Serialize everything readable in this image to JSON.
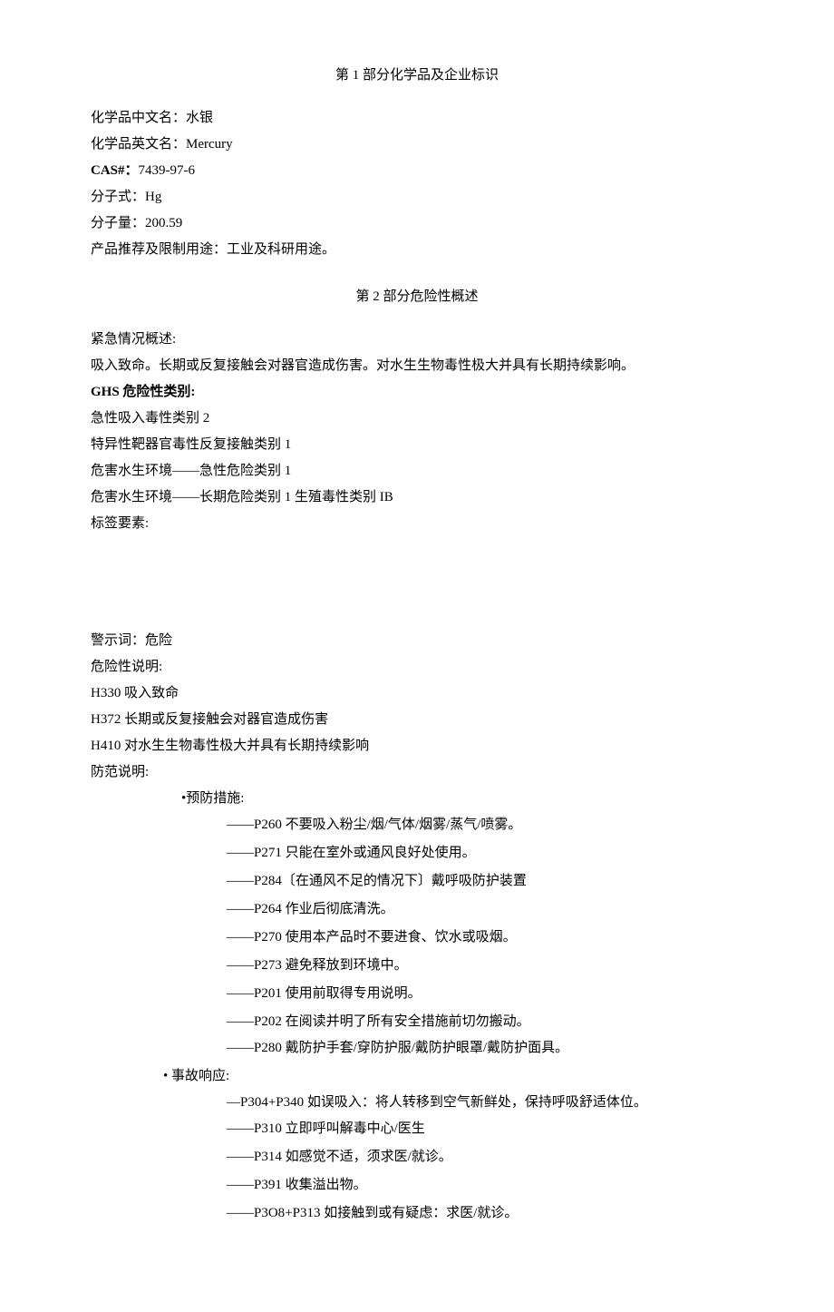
{
  "section1": {
    "title": "第 1 部分化学品及企业标识",
    "name_cn_label": "化学品中文名：",
    "name_cn": "水银",
    "name_en_label": "化学品英文名：",
    "name_en": "Mercury",
    "cas_label": "CAS#：",
    "cas": "7439-97-6",
    "formula_label": "分子式：",
    "formula": "Hg",
    "mw_label": "分子量：",
    "mw": "200.59",
    "use_label": "产品推荐及限制用途：",
    "use": "工业及科研用途。"
  },
  "section2": {
    "title": "第 2 部分危险性概述",
    "emergency_label": "紧急情况概述:",
    "emergency_text": "吸入致命。长期或反复接触会对器官造成伤害。对水生生物毒性极大并具有长期持续影响。",
    "ghs_label": "GHS 危险性类别:",
    "ghs_items": [
      "急性吸入毒性类别 2",
      "特异性靶器官毒性反复接触类别 1",
      "危害水生环境——急性危险类别 1",
      "危害水生环境——长期危险类别 1 生殖毒性类别 IB"
    ],
    "label_elements": "标签要素:",
    "signal_word": "警示词：危险",
    "hazard_label": "危险性说明:",
    "hazard_items": [
      "H330 吸入致命",
      "H372 长期或反复接触会对器官造成伤害",
      "H410 对水生生物毒性极大并具有长期持续影响"
    ],
    "precaution_label": "防范说明:",
    "prevention_header": "•预防措施:",
    "prevention_items": [
      "——P260 不要吸入粉尘/烟/气体/烟雾/蒸气/喷雾。",
      "——P271 只能在室外或通风良好处使用。",
      "——P284〔在通风不足的情况下〕戴呼吸防护装置",
      "——P264 作业后彻底清洗。",
      "——P270 使用本产品时不要进食、饮水或吸烟。",
      "——P273 避免释放到环境中。",
      "——P201 使用前取得专用说明。",
      "——P202 在阅读并明了所有安全措施前切勿搬动。",
      "——P280 戴防护手套/穿防护服/戴防护眼罩/戴防护面具。"
    ],
    "response_header": "•    事故响应:",
    "response_items": [
      "—P304+P340 如误吸入：将人转移到空气新鲜处，保持呼吸舒适体位。",
      "——P310 立即呼叫解毒中心/医生",
      "——P314 如感觉不适，须求医/就诊。",
      "——P391 收集溢出物。",
      "——P3O8+P313 如接触到或有疑虑：求医/就诊。"
    ]
  }
}
